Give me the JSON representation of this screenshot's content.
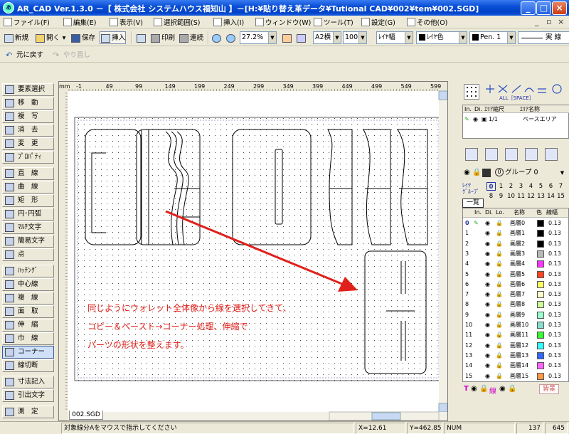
{
  "window": {
    "title": "AR_CAD Ver.1.3.0 －【 株式会社 システムハウス福知山 】－[H:¥貼り替え革データ¥Tutional CAD¥002¥tem¥002.SGD]",
    "icon": "ar-cad-app-icon",
    "min": "_",
    "max": "□",
    "close": "×"
  },
  "menu": {
    "items": [
      "ファイル(F)",
      "編集(E)",
      "表示(V)",
      "選択範囲(S)",
      "挿入(I)",
      "ウィンドウ(W)",
      "ツール(T)",
      "設定(G)",
      "その他(O)"
    ],
    "mdi_min": "_",
    "mdi_restore": "▫",
    "mdi_close": "×"
  },
  "toolbar1": {
    "new": "新規",
    "open": "開く",
    "save": "保存",
    "insert": "挿入",
    "print": "印刷",
    "continuous": "連続",
    "zoom_value": "27.2%",
    "paper": "A2横",
    "scale": "100",
    "line_width_mode": "ﾚｲﾔ幅",
    "color_mode": "ﾚｲﾔ色",
    "pen": "Pen. 1",
    "line_type": "実 線"
  },
  "toolbar2": {
    "undo": "元に戻す",
    "redo": "やり直し"
  },
  "tools": [
    "要素選択",
    "移　動",
    "複　写",
    "消　去",
    "変　更",
    "ﾌﾟﾛﾊﾟﾃｨ",
    "直　線",
    "曲　線",
    "矩　形",
    "円･円弧",
    "ﾏﾙﾁ文字",
    "簡易文字",
    "点",
    "ﾊｯﾁﾝｸﾞ",
    "中心線",
    "複　線",
    "面　取",
    "伸　縮",
    "巾　線",
    "コーナー",
    "線切断",
    "寸法記入",
    "引出文字",
    "測　定"
  ],
  "active_tool": "コーナー",
  "ruler": {
    "unit": "mm",
    "labels": [
      "-1",
      "49",
      "99",
      "149",
      "199",
      "249",
      "299",
      "349",
      "399",
      "449",
      "499",
      "549",
      "599"
    ]
  },
  "annotation": {
    "lines": [
      "同じようにウォレット全体像から線を選択してきて、",
      "コピー＆ペースト→コーナー処理、伸縮で",
      "パーツの形状を整えます。"
    ],
    "color": "#e0201a"
  },
  "tab": {
    "label": "002.SGD"
  },
  "snap": {
    "all_label": "ALL［SPACE］"
  },
  "area": {
    "headers": [
      "In.",
      "Di.",
      "ｴﾘｱ縮尺",
      "ｴﾘｱ名称"
    ],
    "row": {
      "scale": "1/1",
      "name": "ベースエリア"
    }
  },
  "group": {
    "label": "グループ 0",
    "layer_group_label": "ﾚｲﾔ\nｸﾞﾙｰﾌﾟ",
    "list_button": "一覧",
    "numbers": [
      "0",
      "1",
      "2",
      "3",
      "4",
      "5",
      "6",
      "7",
      "8",
      "9",
      "10",
      "11",
      "12",
      "13",
      "14",
      "15"
    ]
  },
  "layers": {
    "headers": [
      "In.",
      "Di.",
      "Lo.",
      "名称",
      "色",
      "線幅"
    ],
    "rows": [
      {
        "no": "0",
        "name": "画層0",
        "color": "#000000",
        "width": "0.13"
      },
      {
        "no": "1",
        "name": "画層1",
        "color": "#000000",
        "width": "0.13"
      },
      {
        "no": "2",
        "name": "画層2",
        "color": "#000000",
        "width": "0.13"
      },
      {
        "no": "3",
        "name": "画層3",
        "color": "#b8b8b8",
        "width": "0.13"
      },
      {
        "no": "4",
        "name": "画層4",
        "color": "#ff33ff",
        "width": "0.13"
      },
      {
        "no": "5",
        "name": "画層5",
        "color": "#ff4422",
        "width": "0.13"
      },
      {
        "no": "6",
        "name": "画層6",
        "color": "#ffff66",
        "width": "0.13"
      },
      {
        "no": "7",
        "name": "画層7",
        "color": "#ffffcc",
        "width": "0.13"
      },
      {
        "no": "8",
        "name": "画層8",
        "color": "#ccff99",
        "width": "0.13"
      },
      {
        "no": "9",
        "name": "画層9",
        "color": "#99ffcc",
        "width": "0.13"
      },
      {
        "no": "10",
        "name": "画層10",
        "color": "#88ddcc",
        "width": "0.13"
      },
      {
        "no": "11",
        "name": "画層11",
        "color": "#33ff33",
        "width": "0.13"
      },
      {
        "no": "12",
        "name": "画層12",
        "color": "#33ffff",
        "width": "0.13"
      },
      {
        "no": "13",
        "name": "画層13",
        "color": "#3366ff",
        "width": "0.13"
      },
      {
        "no": "14",
        "name": "画層14",
        "color": "#ff66ff",
        "width": "0.13"
      },
      {
        "no": "15",
        "name": "画層15",
        "color": "#ff9944",
        "width": "0.13"
      }
    ],
    "footer_t": "T",
    "footer_line": "線",
    "footer_btn": "皆景"
  },
  "status": {
    "message": "対象線分Aをマウスで指示してください",
    "x": "X=12.61",
    "y": "Y=462.85",
    "num": "NUM",
    "val1": "137",
    "val2": "645"
  }
}
